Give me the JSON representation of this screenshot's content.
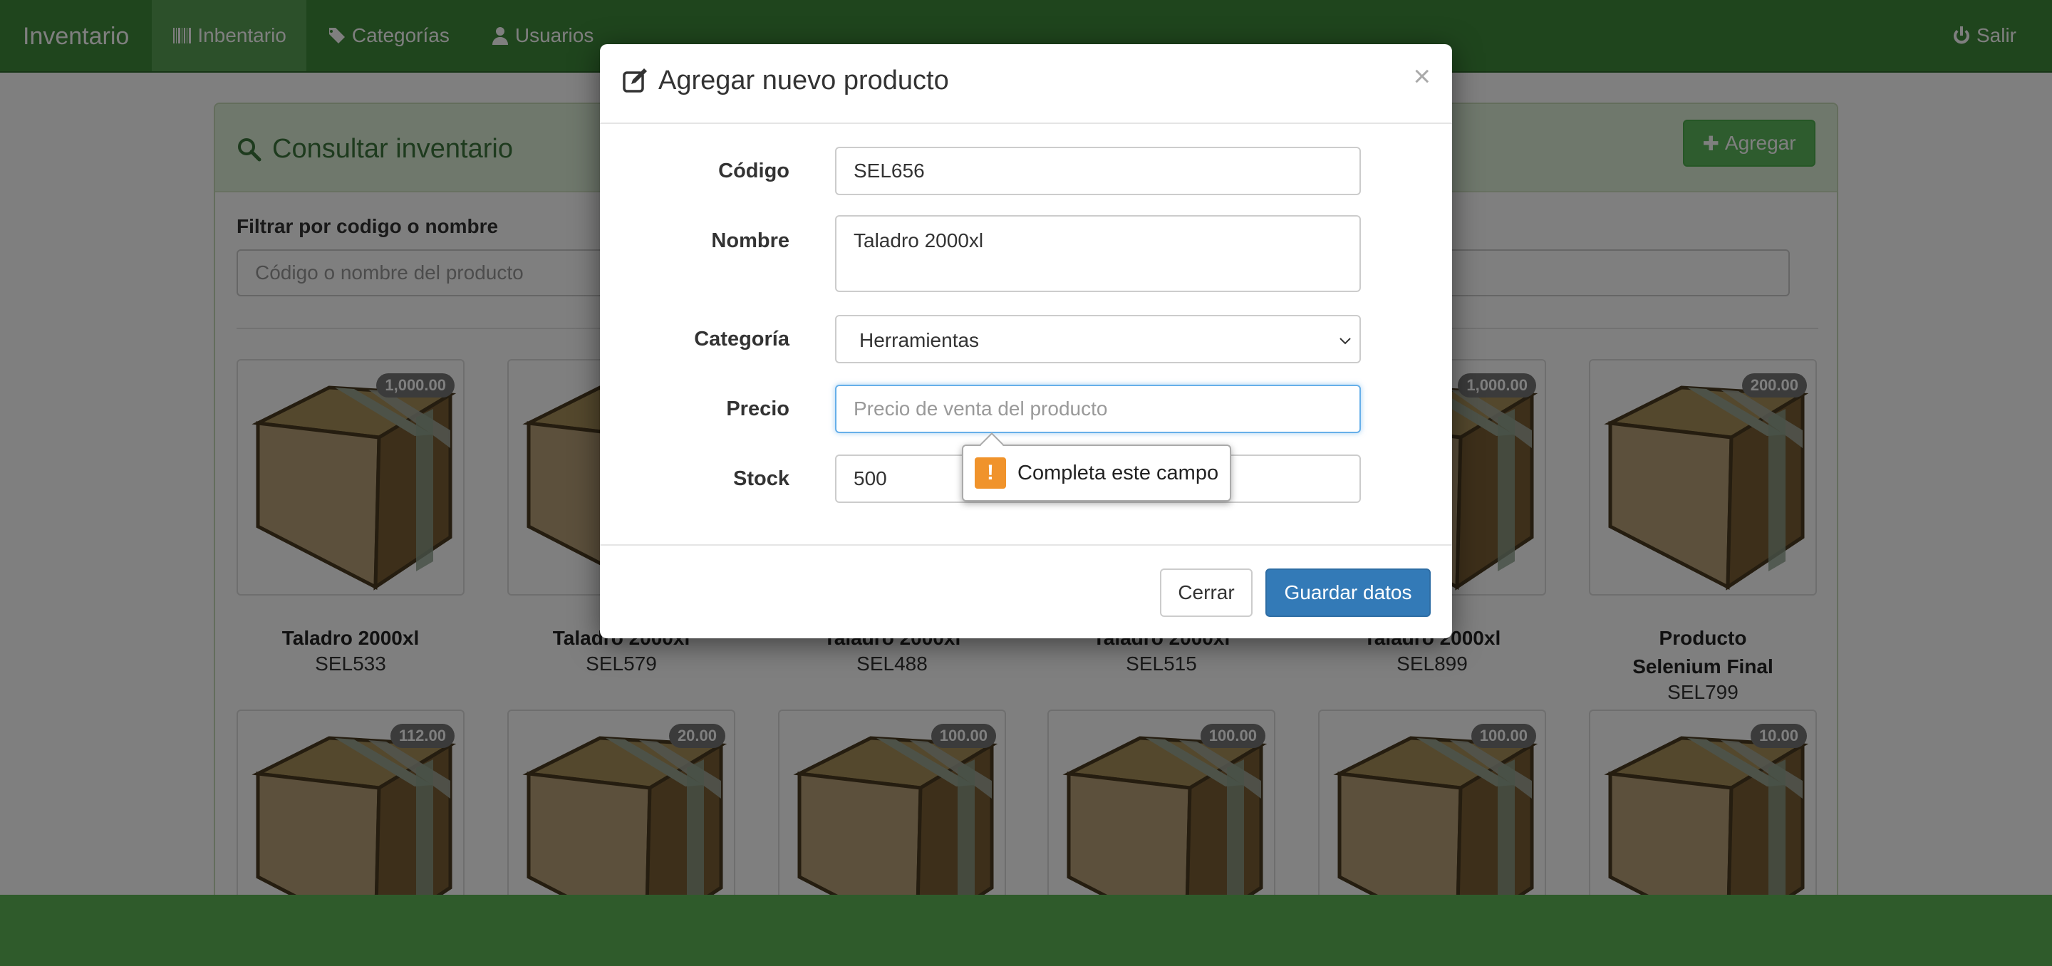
{
  "navbar": {
    "brand": "Inventario",
    "items": [
      {
        "label": "Inbentario",
        "icon": "barcode-icon"
      },
      {
        "label": "Categorías",
        "icon": "tags-icon"
      },
      {
        "label": "Usuarios",
        "icon": "user-icon"
      }
    ],
    "logout": {
      "label": "Salir",
      "icon": "power-icon"
    }
  },
  "panel": {
    "title": "Consultar inventario",
    "add_label": "Agregar",
    "filter_label": "Filtrar por codigo o nombre",
    "filter_placeholder": "Código o nombre del producto"
  },
  "products": [
    {
      "name": "Taladro 2000xl",
      "code": "SEL533",
      "price": "1,000.00"
    },
    {
      "name": "Taladro 2000xl",
      "code": "SEL579",
      "price": ""
    },
    {
      "name": "Taladro 2000xl",
      "code": "SEL488",
      "price": ""
    },
    {
      "name": "Taladro 2000xl",
      "code": "SEL515",
      "price": ""
    },
    {
      "name": "Taladro 2000xl",
      "code": "SEL899",
      "price": "1,000.00"
    },
    {
      "name": "Producto Selenium Final",
      "code": "SEL799",
      "price": "200.00"
    },
    {
      "price": "112.00"
    },
    {
      "price": "20.00"
    },
    {
      "price": "100.00"
    },
    {
      "price": "100.00"
    },
    {
      "price": "100.00"
    },
    {
      "price": "10.00"
    }
  ],
  "modal": {
    "title": "Agregar nuevo producto",
    "close": "×",
    "fields": {
      "codigo": {
        "label": "Código",
        "value": "SEL656"
      },
      "nombre": {
        "label": "Nombre",
        "value": "Taladro 2000xl"
      },
      "categoria": {
        "label": "Categoría",
        "value": "Herramientas"
      },
      "precio": {
        "label": "Precio",
        "placeholder": "Precio de venta del producto"
      },
      "stock": {
        "label": "Stock",
        "value": "500"
      }
    },
    "cerrar_label": "Cerrar",
    "guardar_label": "Guardar datos"
  },
  "validation": {
    "message": "Completa este campo",
    "icon": "!"
  },
  "colors": {
    "navbar": "#3f8a3b",
    "panel_heading": "#dff0d8",
    "success_button": "#5cb85c",
    "primary_button": "#337ab7",
    "warning": "#f0932b"
  }
}
